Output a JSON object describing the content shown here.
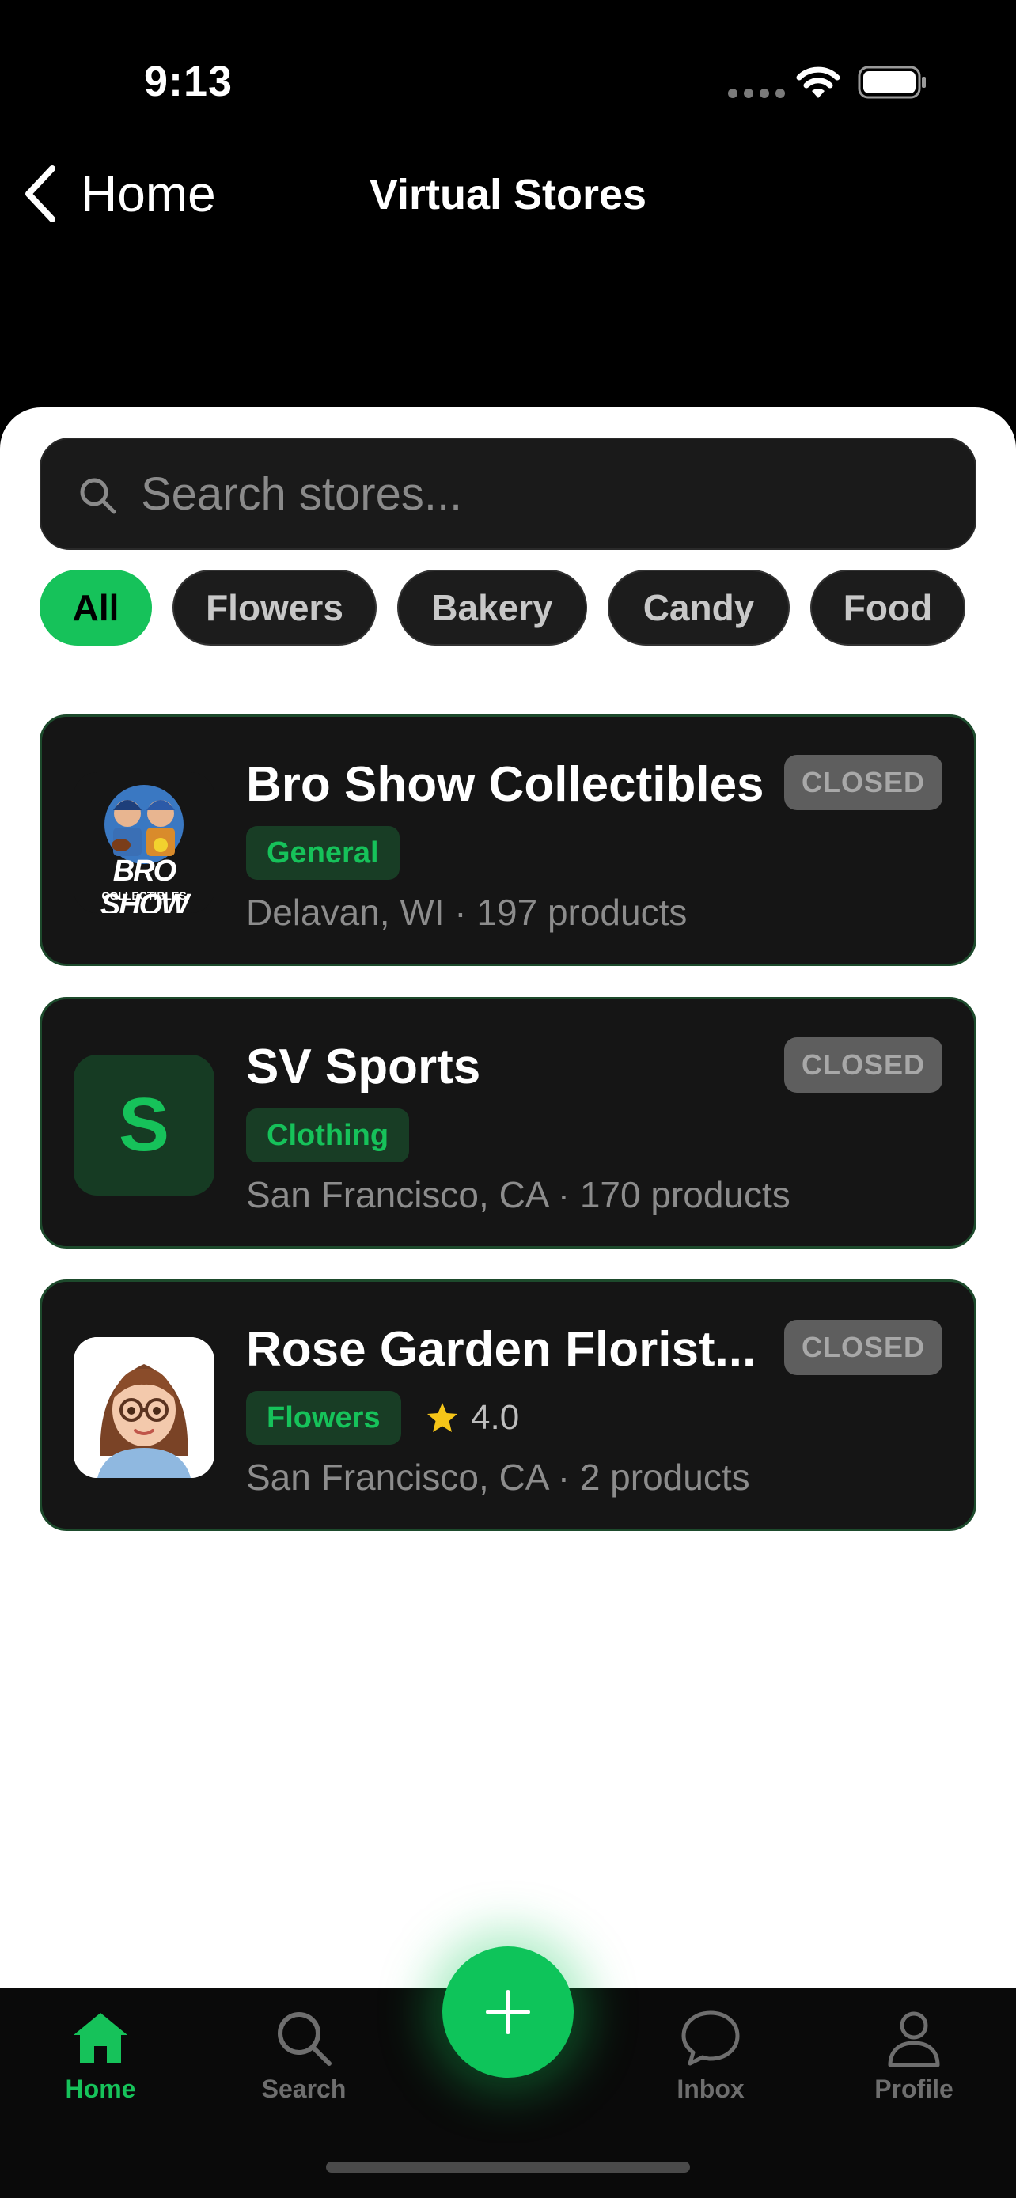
{
  "status_bar": {
    "time": "9:13"
  },
  "nav": {
    "back_label": "Home",
    "title": "Virtual Stores"
  },
  "search": {
    "placeholder": "Search stores..."
  },
  "filters": [
    {
      "label": "All",
      "active": true
    },
    {
      "label": "Flowers",
      "active": false
    },
    {
      "label": "Bakery",
      "active": false
    },
    {
      "label": "Candy",
      "active": false
    },
    {
      "label": "Food",
      "active": false
    }
  ],
  "stores": [
    {
      "name": "Bro Show Collectibles",
      "status": "CLOSED",
      "category": "General",
      "meta": "Delavan, WI · 197 products",
      "logo_text": [
        "BRO SHOW",
        "COLLECTIBLES"
      ]
    },
    {
      "name": "SV Sports",
      "status": "CLOSED",
      "category": "Clothing",
      "meta": "San Francisco, CA · 170 products",
      "thumb_letter": "S"
    },
    {
      "name": "Rose Garden Florist...",
      "status": "CLOSED",
      "category": "Flowers",
      "rating": "4.0",
      "meta": "San Francisco, CA · 2 products"
    }
  ],
  "tabs": [
    {
      "label": "Home",
      "icon": "house-icon",
      "active": true
    },
    {
      "label": "Search",
      "icon": "search-icon",
      "active": false
    },
    {
      "label": "Inbox",
      "icon": "chat-bubble-icon",
      "active": false
    },
    {
      "label": "Profile",
      "icon": "person-icon",
      "active": false
    }
  ],
  "colors": {
    "accent": "#16c25a",
    "card_bg": "#151515",
    "card_border": "#1d4a2c",
    "closed_pill": "#5e5e5e",
    "star": "#f5c518"
  }
}
